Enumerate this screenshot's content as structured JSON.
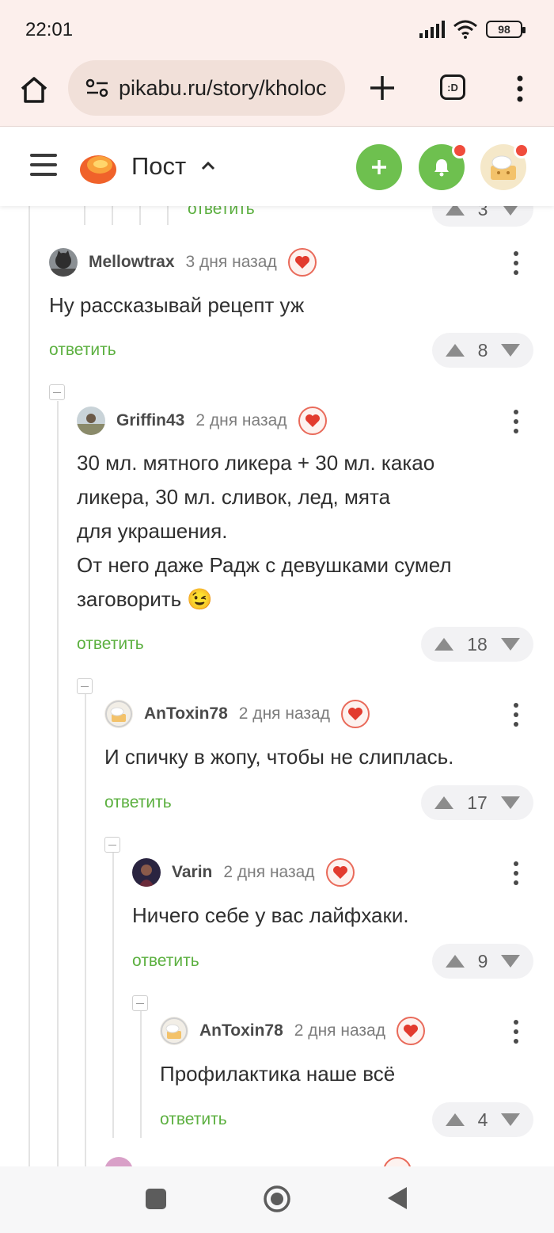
{
  "status": {
    "time": "22:01",
    "battery": "98"
  },
  "browser": {
    "url": "pikabu.ru/story/kholoc",
    "tabs_label": ":D"
  },
  "header": {
    "title": "Пост"
  },
  "colors": {
    "accent_green": "#6ec04f",
    "reply_green": "#5cb040",
    "notification_red": "#f04c3c"
  },
  "partial_top": {
    "reply_label": "ответить",
    "votes": "3"
  },
  "comments": [
    {
      "user": "Mellowtrax",
      "time": "3 дня назад",
      "text": "Ну рассказывай рецепт уж",
      "reply_label": "ответить",
      "votes": "8"
    },
    {
      "user": "Griffin43",
      "time": "2 дня назад",
      "text_lines": [
        "30 мл. мятного ликера + 30 мл. какао",
        "ликера, 30 мл. сливок, лед, мята",
        "для украшения.",
        "От него даже Радж с девушками сумел",
        "заговорить 😉"
      ],
      "reply_label": "ответить",
      "votes": "18"
    },
    {
      "user": "AnToxin78",
      "time": "2 дня назад",
      "text": "И спичку в жопу, чтобы не слиплась.",
      "reply_label": "ответить",
      "votes": "17"
    },
    {
      "user": "Varin",
      "time": "2 дня назад",
      "text": "Ничего себе у вас лайфхаки.",
      "reply_label": "ответить",
      "votes": "9"
    },
    {
      "user": "AnToxin78",
      "time": "2 дня назад",
      "text": "Профилактика наше всё",
      "reply_label": "ответить",
      "votes": "4"
    }
  ]
}
